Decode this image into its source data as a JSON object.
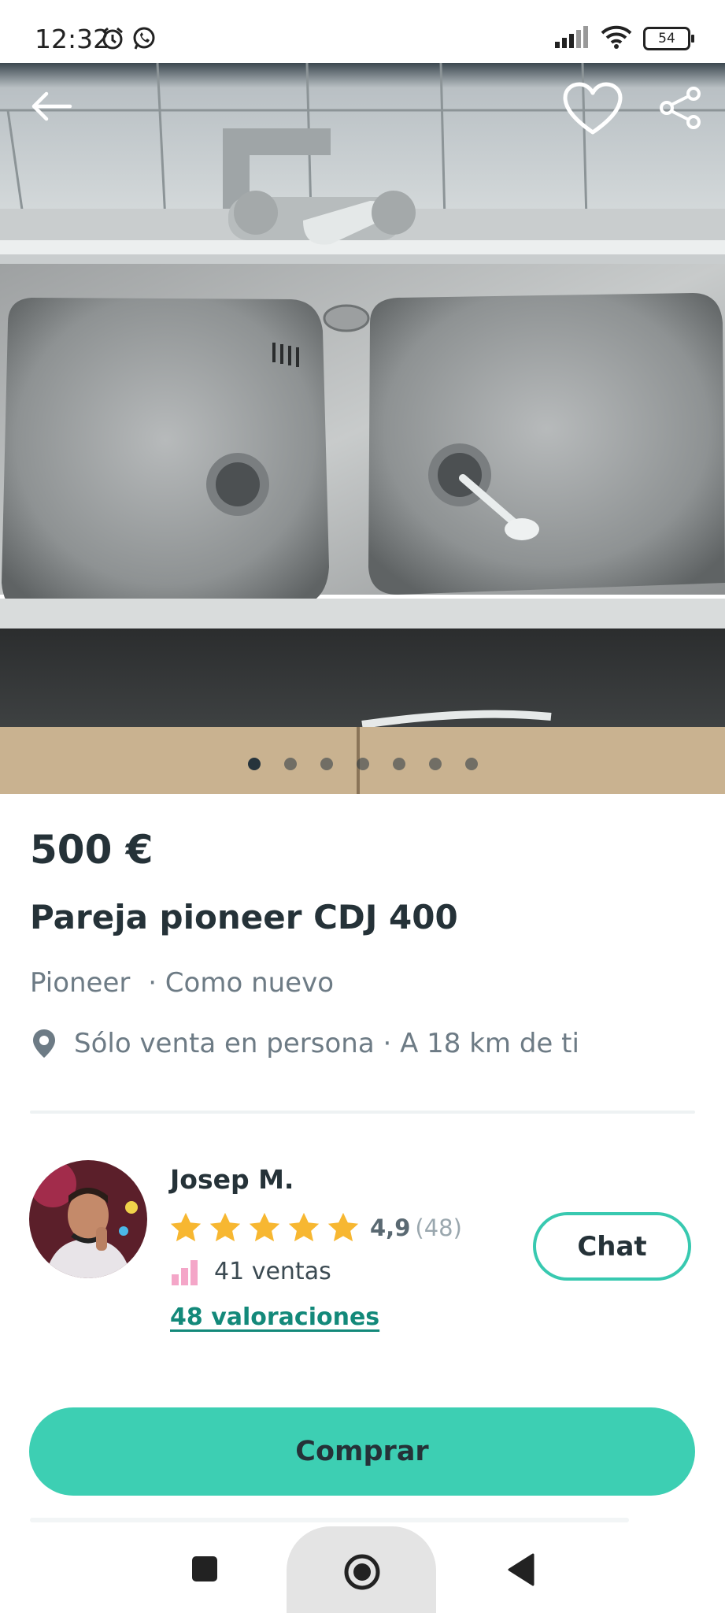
{
  "status_bar": {
    "time": "12:32",
    "battery": "54",
    "icons_left": [
      "alarm-icon",
      "whatsapp-icon"
    ],
    "icons_right": [
      "signal-icon",
      "wifi-icon",
      "battery-icon"
    ]
  },
  "hero": {
    "image": "photo of a double stainless steel kitchen sink with faucet",
    "image_count": 7,
    "active_index": 0,
    "buttons": [
      "back-arrow-icon",
      "heart-icon",
      "share-icon"
    ]
  },
  "listing": {
    "price": "500 €",
    "title": "Pareja pioneer CDJ 400",
    "brand": "Pioneer",
    "condition": "· Como nuevo",
    "location": "Sólo venta en persona · A 18 km de ti"
  },
  "seller": {
    "name": "Josep M.",
    "stars": 5,
    "rating": "4,9",
    "rating_count": "(48)",
    "sales": "41 ventas",
    "reviews_link": "48 valoraciones",
    "chat_label": "Chat"
  },
  "actions": {
    "buy_label": "Comprar"
  },
  "colors": {
    "accent": "#3dcfb3",
    "accent_dark": "#13897a",
    "star": "#f7b731",
    "text": "#253238",
    "muted": "#6d7b85",
    "sales_icon": "#f4a6c8"
  }
}
